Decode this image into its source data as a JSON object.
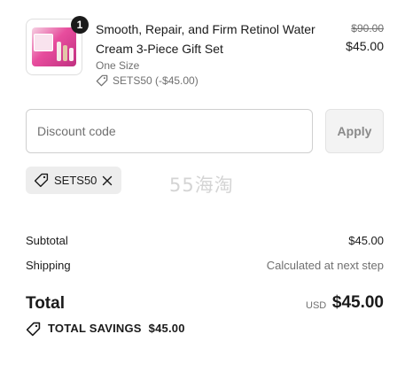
{
  "product": {
    "quantity": "1",
    "title": "Smooth, Repair, and Firm Retinol Water Cream 3-Piece Gift Set",
    "variant": "One Size",
    "discount_line": "SETS50 (-$45.00)",
    "price_original": "$90.00",
    "price_final": "$45.00",
    "image_icon": "product-thumbnail",
    "colors": {
      "image_accent": "#e74d9d"
    }
  },
  "discount": {
    "placeholder": "Discount code",
    "apply_label": "Apply",
    "applied_code": "SETS50"
  },
  "watermark": "55海淘",
  "summary": {
    "subtotal_label": "Subtotal",
    "subtotal_value": "$45.00",
    "shipping_label": "Shipping",
    "shipping_value": "Calculated at next step",
    "total_label": "Total",
    "currency": "USD",
    "total_value": "$45.00",
    "savings_label": "TOTAL SAVINGS",
    "savings_value": "$45.00"
  },
  "icons": {
    "tag": "tag-icon",
    "remove": "close-icon"
  }
}
